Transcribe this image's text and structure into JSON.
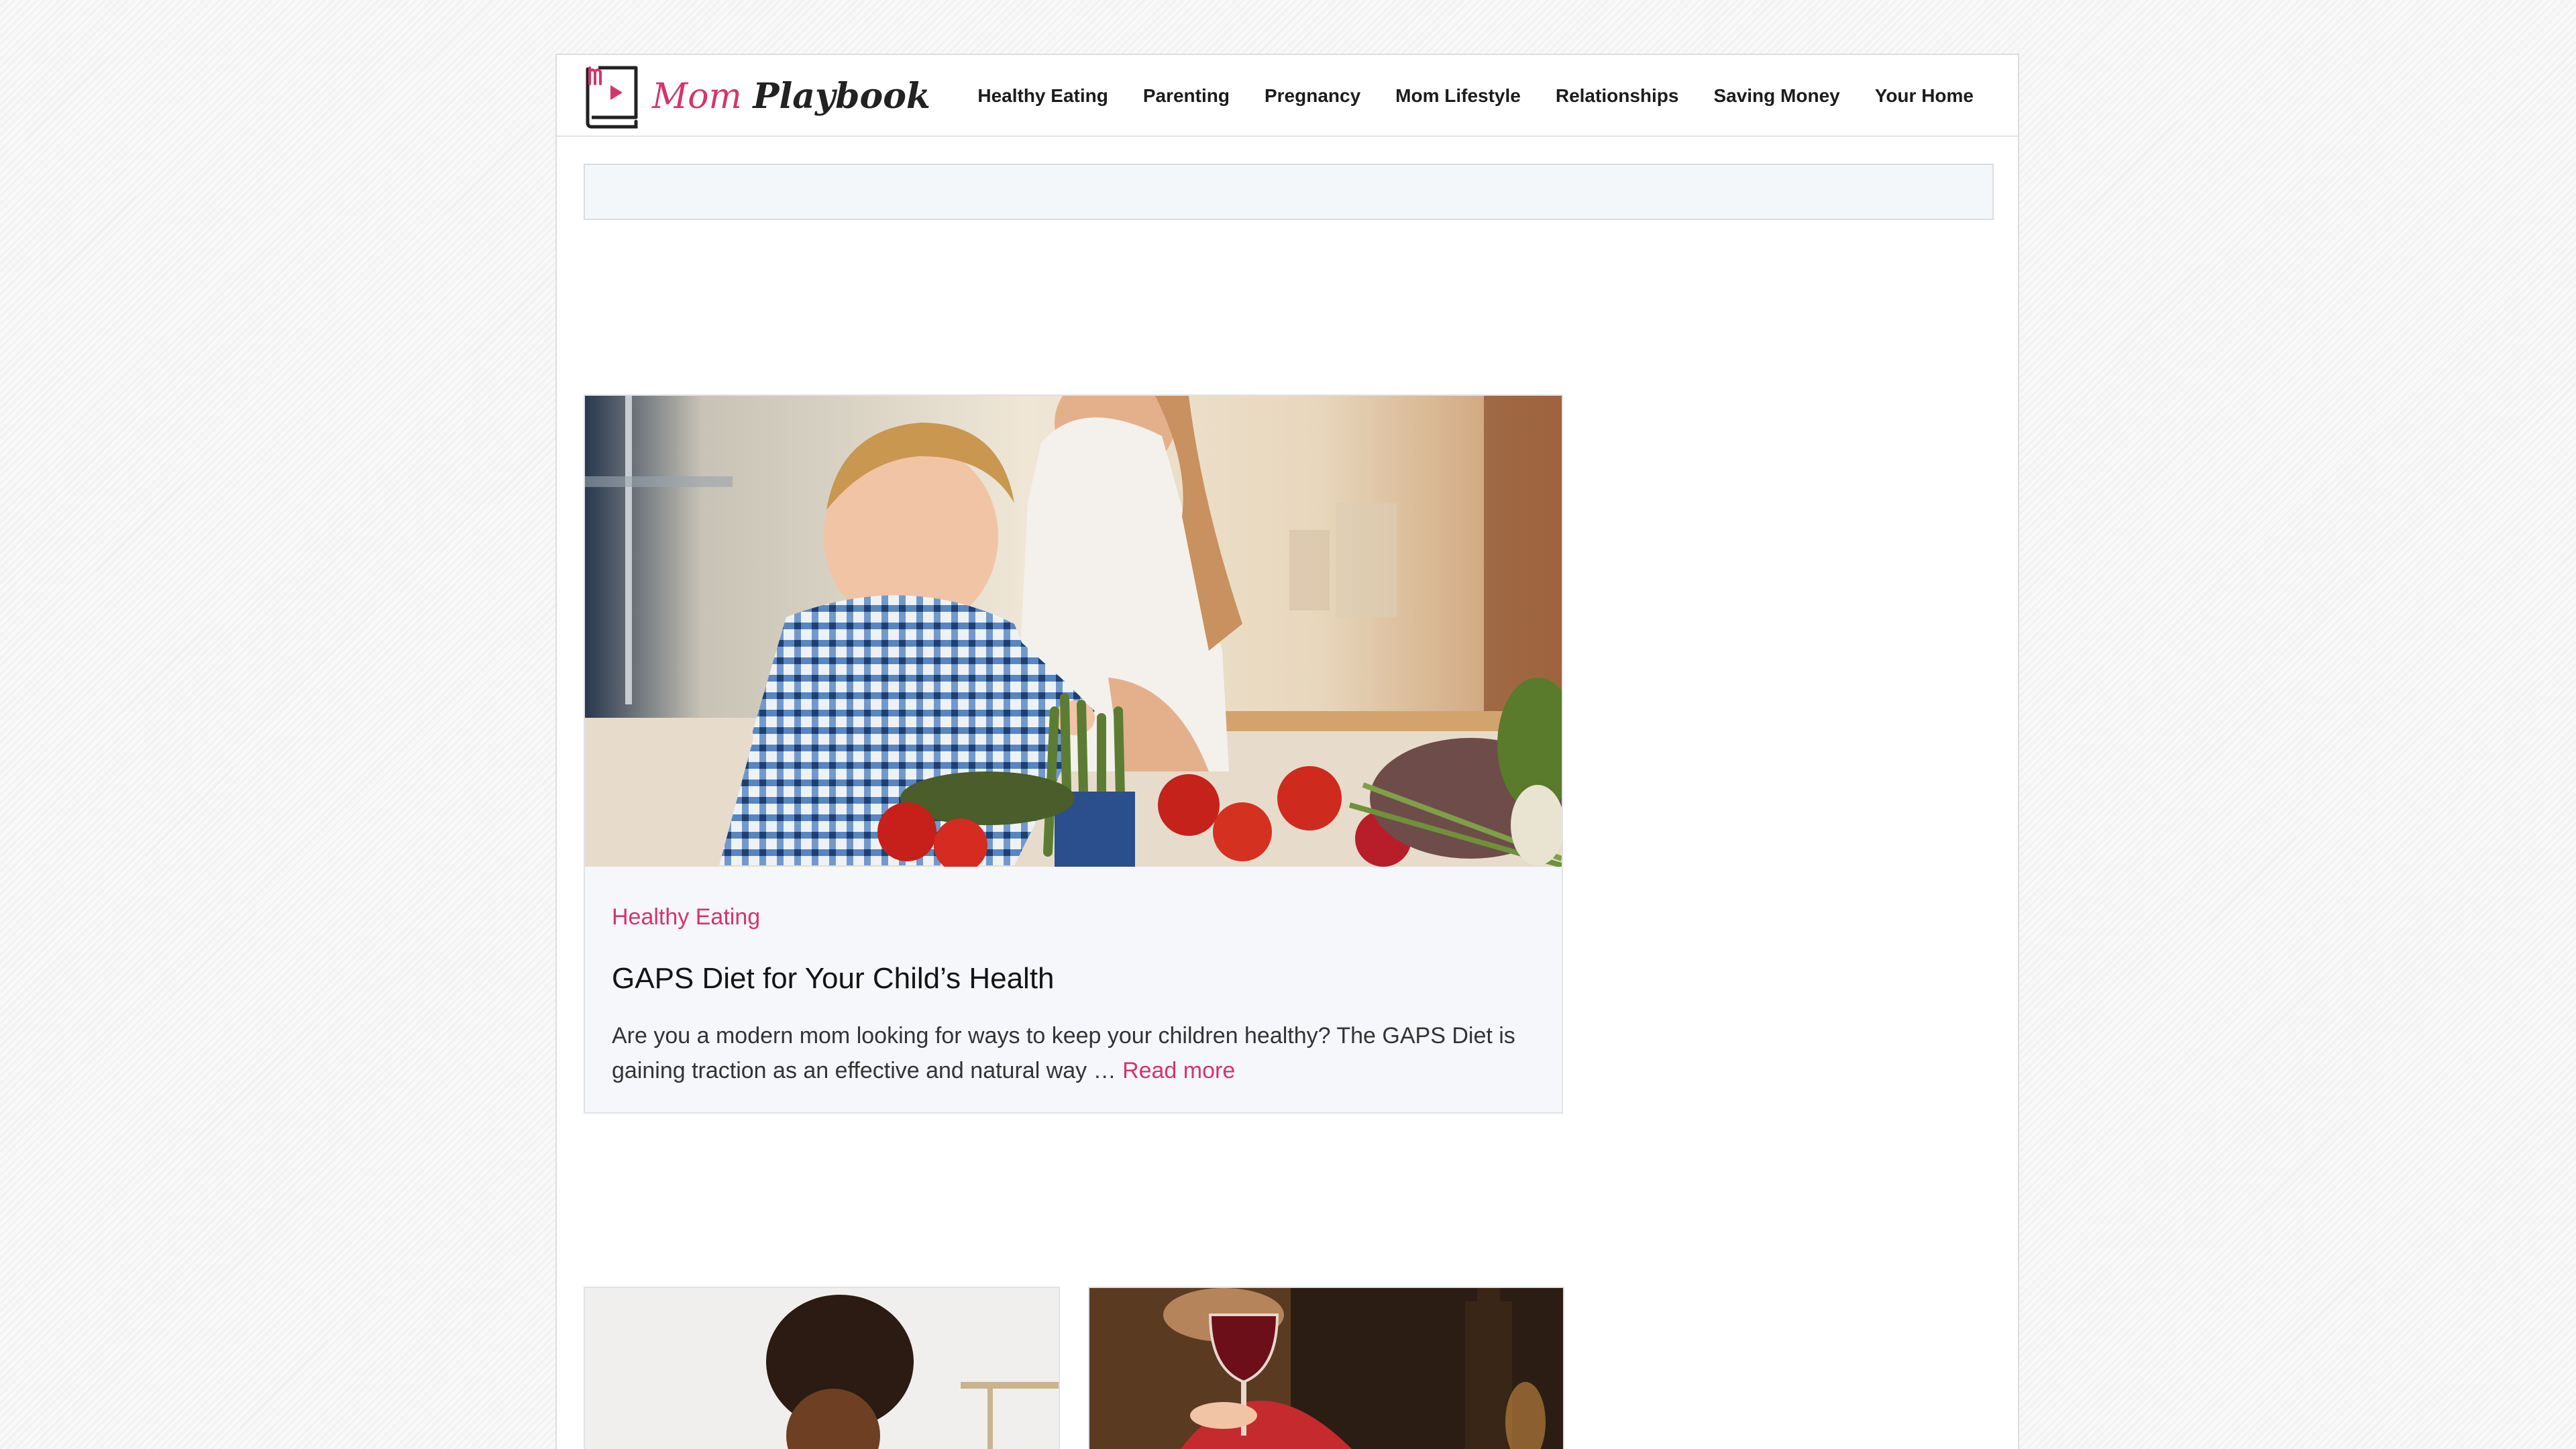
{
  "header": {
    "logo": {
      "part1": "Mom",
      "part2": "Playbook"
    },
    "nav": [
      {
        "label": "Healthy Eating"
      },
      {
        "label": "Parenting"
      },
      {
        "label": "Pregnancy"
      },
      {
        "label": "Mom Lifestyle"
      },
      {
        "label": "Relationships"
      },
      {
        "label": "Saving Money"
      },
      {
        "label": "Your Home"
      }
    ]
  },
  "featured_post": {
    "image_alt": "Toddler helping with vegetables in the kitchen",
    "category": "Healthy Eating",
    "title": "GAPS Diet for Your Child’s Health",
    "excerpt": "Are you a modern mom looking for ways to keep your children healthy? The GAPS Diet is gaining traction as an effective and natural way …",
    "read_more": "Read more"
  },
  "post_cards": [
    {
      "image_alt": "Child doing crafts at a table"
    },
    {
      "image_alt": "Woman holding a glass of red wine"
    }
  ],
  "colors": {
    "accent": "#d6336c",
    "text": "#1c1c1c",
    "panel": "#f5f7fa"
  }
}
